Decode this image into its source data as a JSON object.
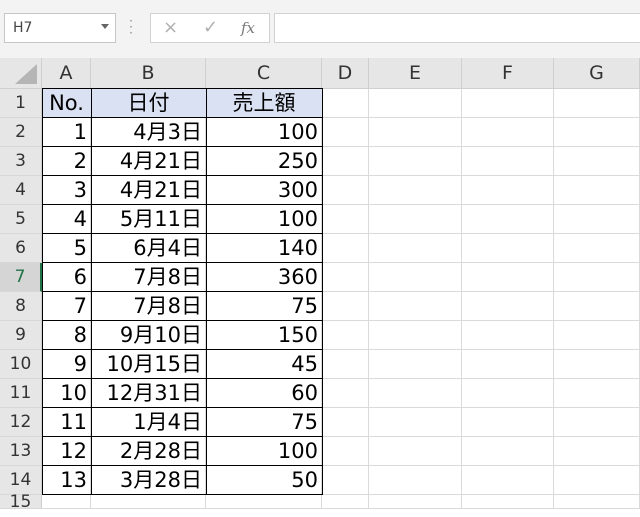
{
  "formula_bar": {
    "name_box": "H7",
    "cancel_icon": "×",
    "enter_icon": "✓",
    "fx_label": "fx",
    "formula": ""
  },
  "columns": [
    "A",
    "B",
    "C",
    "D",
    "E",
    "F",
    "G"
  ],
  "rows": [
    "1",
    "2",
    "3",
    "4",
    "5",
    "6",
    "7",
    "8",
    "9",
    "10",
    "11",
    "12",
    "13",
    "14",
    "15"
  ],
  "selected_row": "7",
  "table": {
    "headers": [
      "No.",
      "日付",
      "売上額"
    ],
    "rows": [
      [
        "1",
        "4月3日",
        "100"
      ],
      [
        "2",
        "4月21日",
        "250"
      ],
      [
        "3",
        "4月21日",
        "300"
      ],
      [
        "4",
        "5月11日",
        "100"
      ],
      [
        "5",
        "6月4日",
        "140"
      ],
      [
        "6",
        "7月8日",
        "360"
      ],
      [
        "7",
        "7月8日",
        "75"
      ],
      [
        "8",
        "9月10日",
        "150"
      ],
      [
        "9",
        "10月15日",
        "45"
      ],
      [
        "10",
        "12月31日",
        "60"
      ],
      [
        "11",
        "1月4日",
        "75"
      ],
      [
        "12",
        "2月28日",
        "100"
      ],
      [
        "13",
        "3月28日",
        "50"
      ]
    ]
  },
  "colors": {
    "header_fill": "#d9e1f2",
    "selection_accent": "#217346"
  }
}
